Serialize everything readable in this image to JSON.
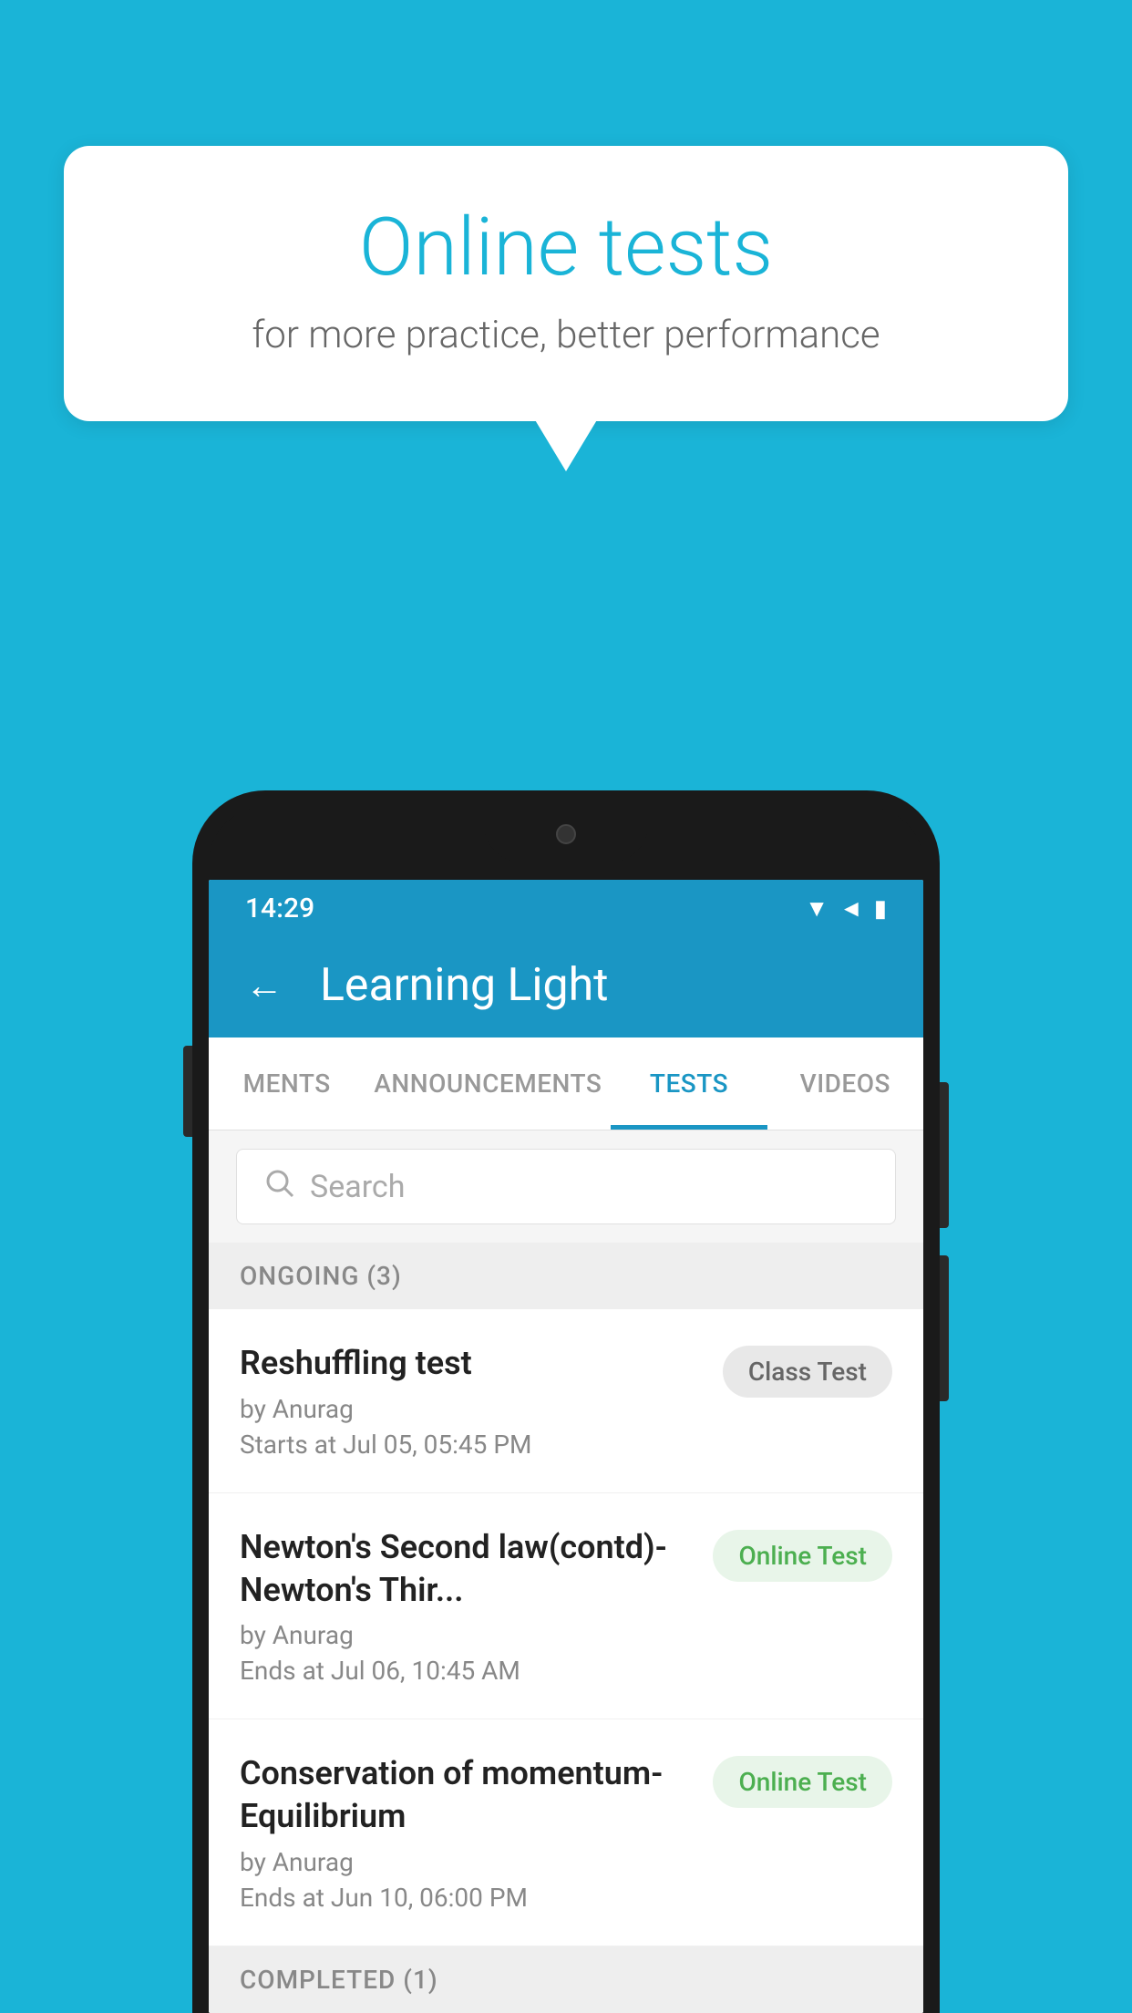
{
  "background_color": "#1ab4d7",
  "speech_bubble": {
    "title": "Online tests",
    "subtitle": "for more practice, better performance"
  },
  "phone": {
    "status_bar": {
      "time": "14:29",
      "icons": [
        "wifi",
        "signal",
        "battery"
      ]
    },
    "app_bar": {
      "back_label": "←",
      "title": "Learning Light"
    },
    "tabs": [
      {
        "label": "MENTS",
        "active": false
      },
      {
        "label": "ANNOUNCEMENTS",
        "active": false
      },
      {
        "label": "TESTS",
        "active": true
      },
      {
        "label": "VIDEOS",
        "active": false
      }
    ],
    "search": {
      "placeholder": "Search",
      "icon": "🔍"
    },
    "sections": [
      {
        "header": "ONGOING (3)",
        "items": [
          {
            "title": "Reshuffling test",
            "author": "by Anurag",
            "date_label": "Starts at",
            "date": "Jul 05, 05:45 PM",
            "badge": "Class Test",
            "badge_type": "class"
          },
          {
            "title": "Newton's Second law(contd)-Newton's Thir...",
            "author": "by Anurag",
            "date_label": "Ends at",
            "date": "Jul 06, 10:45 AM",
            "badge": "Online Test",
            "badge_type": "online"
          },
          {
            "title": "Conservation of momentum-Equilibrium",
            "author": "by Anurag",
            "date_label": "Ends at",
            "date": "Jun 10, 06:00 PM",
            "badge": "Online Test",
            "badge_type": "online"
          }
        ]
      }
    ],
    "bottom_section": {
      "header": "COMPLETED (1)"
    }
  }
}
